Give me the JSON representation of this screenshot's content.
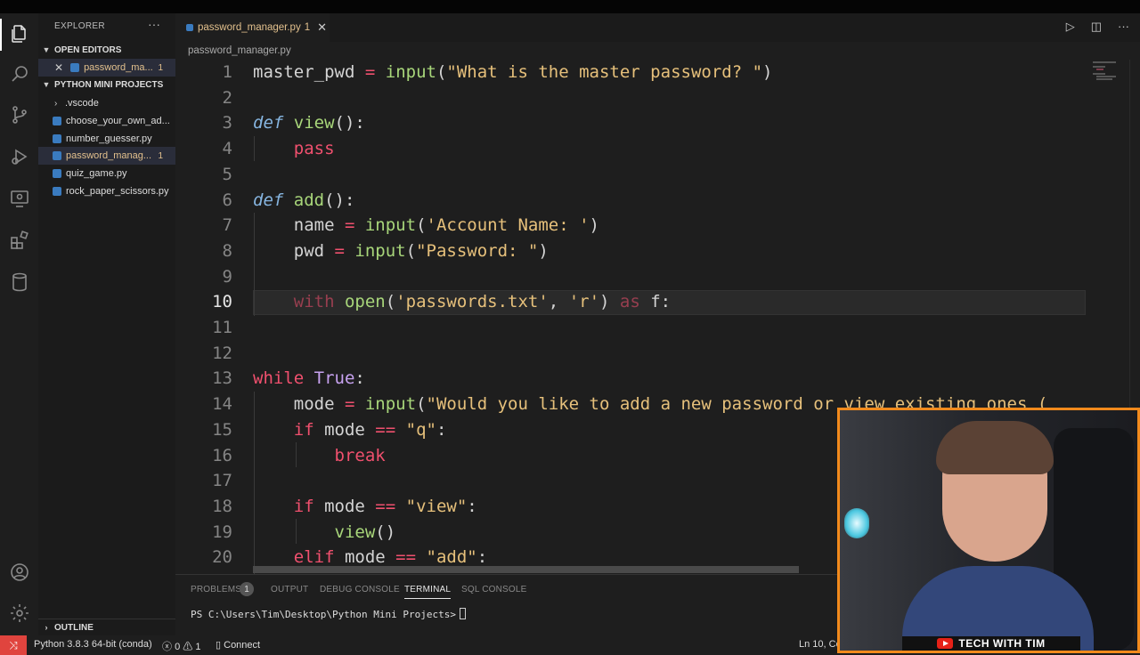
{
  "sidebar": {
    "title": "EXPLORER",
    "more": "···",
    "open_editors_label": "OPEN EDITORS",
    "open_editor": {
      "name": "password_ma...",
      "badge": "1"
    },
    "project_label": "PYTHON MINI PROJECTS",
    "items": [
      {
        "name": ".vscode"
      },
      {
        "name": "choose_your_own_ad..."
      },
      {
        "name": "number_guesser.py"
      },
      {
        "name": "password_manag...",
        "badge": "1"
      },
      {
        "name": "quiz_game.py"
      },
      {
        "name": "rock_paper_scissors.py"
      }
    ],
    "outline_label": "OUTLINE"
  },
  "tab": {
    "label": "password_manager.py",
    "badge": "1"
  },
  "breadcrumb": "password_manager.py",
  "editor": {
    "line_numbers": [
      "1",
      "2",
      "3",
      "4",
      "5",
      "6",
      "7",
      "8",
      "9",
      "10",
      "11",
      "12",
      "13",
      "14",
      "15",
      "16",
      "17",
      "18",
      "19",
      "20"
    ],
    "current_line": "10"
  },
  "panel": {
    "tabs": {
      "problems": "PROBLEMS",
      "problems_count": "1",
      "output": "OUTPUT",
      "debug": "DEBUG CONSOLE",
      "terminal": "TERMINAL",
      "sql": "SQL CONSOLE"
    },
    "prompt": "PS C:\\Users\\Tim\\Desktop\\Python Mini Projects>"
  },
  "status": {
    "interpreter": "Python 3.8.3 64-bit (conda)",
    "errors": "0",
    "warnings": "1",
    "connect": "Connect",
    "position": "Ln 10, Co"
  },
  "webcam": {
    "banner": "TECH WITH TIM"
  },
  "colors": {
    "accent": "#f28a1c",
    "remote": "#e0443e",
    "keyword": "#f0506e",
    "string": "#e6c07b",
    "function": "#a8d67a"
  }
}
